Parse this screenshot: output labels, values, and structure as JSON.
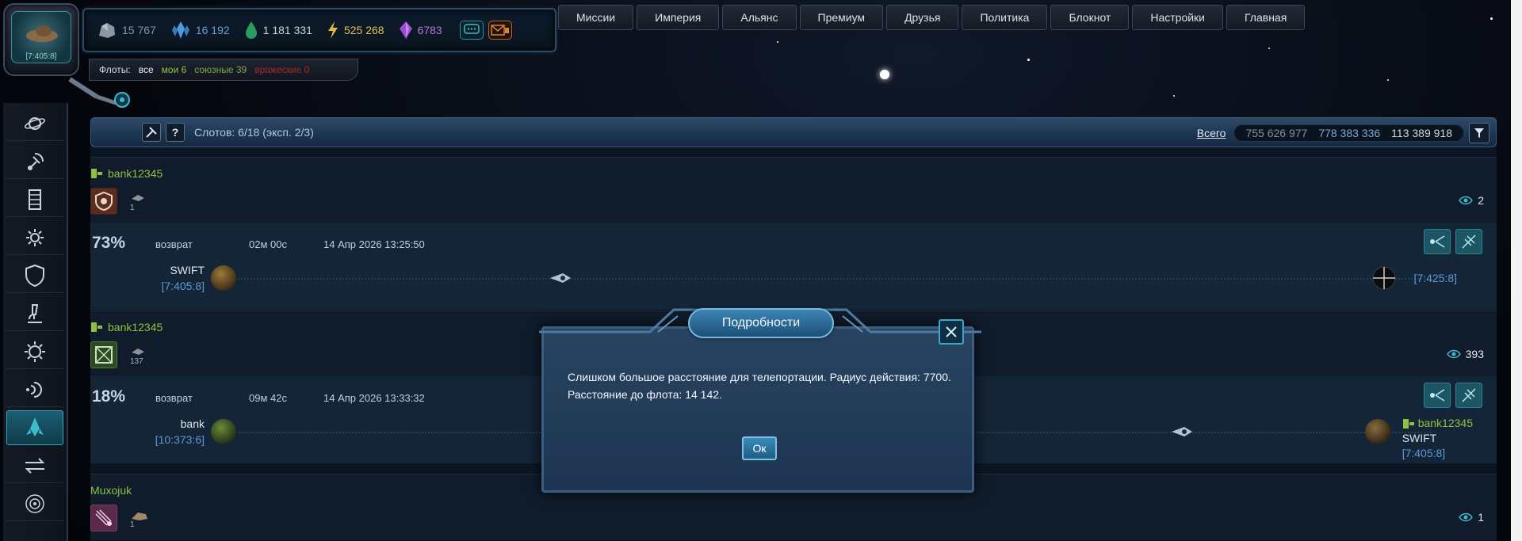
{
  "avatar": {
    "coords": "[7:405:8]"
  },
  "resources": {
    "metal": "15 767",
    "crystal": "16 192",
    "deuterium": "1 181 331",
    "energy": "525 268",
    "dark_matter": "6783"
  },
  "fleets_filter": {
    "label": "Флоты:",
    "all": "все",
    "mine": "мои 6",
    "allied": "союзные 39",
    "hostile": "вражеские 0"
  },
  "nav": [
    "Миссии",
    "Империя",
    "Альянс",
    "Премиум",
    "Друзья",
    "Политика",
    "Блокнот",
    "Настройки",
    "Главная"
  ],
  "header": {
    "help": "?",
    "slots": "Слотов: 6/18 (эксп. 2/3)",
    "totals_label": "Всего",
    "total_metal": "755 626 977",
    "total_crystal": "778 383 336",
    "total_deut": "113 389 918"
  },
  "fleets": [
    {
      "owner": "bank12345",
      "ship_count": "1",
      "observers": "2",
      "percent": "73%",
      "status": "возврат",
      "timer": "02м 00с",
      "arrival": "14 Апр 2026 13:25:50",
      "origin_name": "SWIFT",
      "origin_coords": "[7:405:8]",
      "dest_coords": "[7:425:8]"
    },
    {
      "owner": "bank12345",
      "ship_count": "137",
      "observers": "393",
      "percent": "18%",
      "status": "возврат",
      "timer": "09м 42с",
      "arrival": "14 Апр 2026 13:33:32",
      "origin_name": "bank",
      "origin_coords": "[10:373:6]",
      "dest_owner": "bank12345",
      "dest_name": "SWIFT",
      "dest_coords": "[7:405:8]"
    },
    {
      "owner": "Muxojuk",
      "ship_count": "1",
      "observers": "1"
    }
  ],
  "modal": {
    "title": "Подробности",
    "message": "Слишком большое расстояние для телепортации. Радиус действия: 7700. Расстояние до флота: 14 142.",
    "ok": "Ок"
  },
  "colors": {
    "accent": "#3ea3b8",
    "friendly": "#8fc044",
    "coords": "#5b9ad6",
    "energy": "#e0c14a",
    "dark_matter": "#b07ad8"
  }
}
